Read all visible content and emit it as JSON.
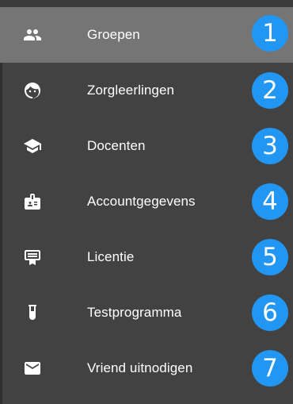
{
  "colors": {
    "sidebar_bg": "#424242",
    "active_bg": "#757575",
    "badge_bg": "#2196f3",
    "text": "#ffffff"
  },
  "menu": {
    "items": [
      {
        "label": "Groepen",
        "icon": "group-icon",
        "badge": "1",
        "active": true
      },
      {
        "label": "Zorgleerlingen",
        "icon": "child-face-icon",
        "badge": "2",
        "active": false
      },
      {
        "label": "Docenten",
        "icon": "graduation-cap-icon",
        "badge": "3",
        "active": false
      },
      {
        "label": "Accountgegevens",
        "icon": "account-badge-icon",
        "badge": "4",
        "active": false
      },
      {
        "label": "Licentie",
        "icon": "certificate-icon",
        "badge": "5",
        "active": false
      },
      {
        "label": "Testprogramma",
        "icon": "test-tube-icon",
        "badge": "6",
        "active": false
      },
      {
        "label": "Vriend uitnodigen",
        "icon": "mail-icon",
        "badge": "7",
        "active": false
      }
    ]
  }
}
